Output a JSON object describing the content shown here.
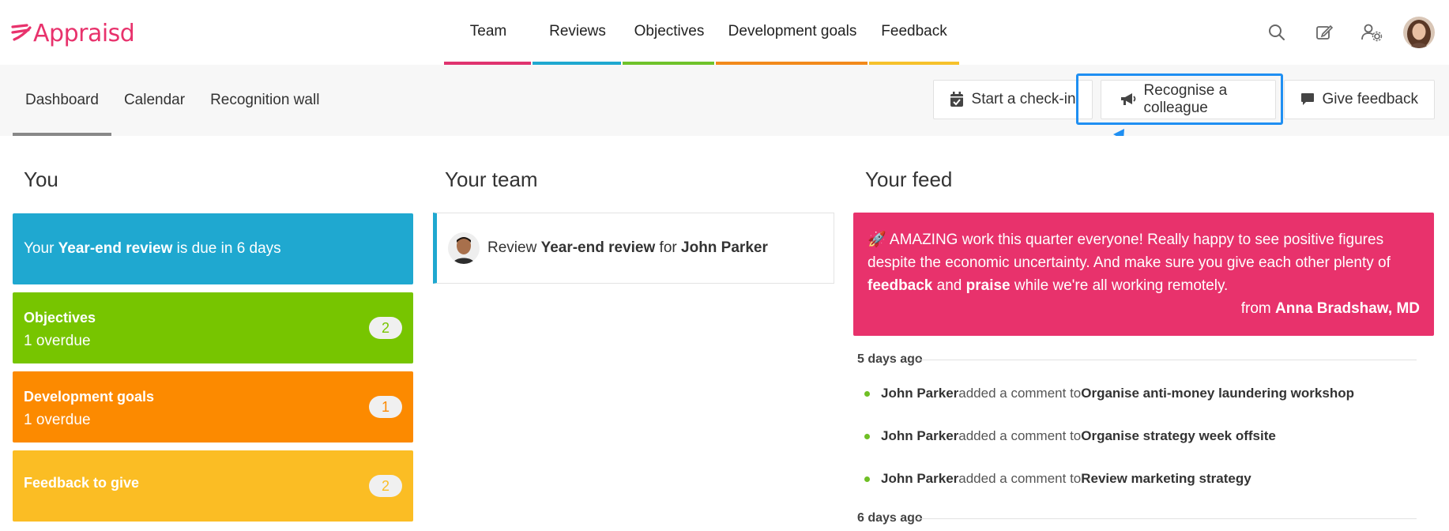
{
  "app": {
    "name": "Appraisd",
    "brand_color": "#e8326c"
  },
  "nav": {
    "items": [
      {
        "label": "Team",
        "color": "#e0336f"
      },
      {
        "label": "Reviews",
        "color": "#1fa8d0"
      },
      {
        "label": "Objectives",
        "color": "#6fc22a"
      },
      {
        "label": "Development goals",
        "color": "#f28a1c"
      },
      {
        "label": "Feedback",
        "color": "#f6c12b"
      }
    ],
    "icons": [
      "search-icon",
      "edit-icon",
      "user-settings-icon"
    ]
  },
  "subnav": {
    "tabs": [
      {
        "label": "Dashboard",
        "active": true
      },
      {
        "label": "Calendar",
        "active": false
      },
      {
        "label": "Recognition wall",
        "active": false
      }
    ],
    "actions": {
      "checkin": "Start a check-in",
      "recognise": "Recognise a colleague",
      "feedback": "Give feedback"
    }
  },
  "you": {
    "title": "You",
    "review_prefix": "Your ",
    "review_name": "Year-end review",
    "review_suffix": " is due in 6 days",
    "objectives": {
      "label": "Objectives",
      "sub": "1 overdue",
      "count": "2"
    },
    "devgoals": {
      "label": "Development goals",
      "sub": "1 overdue",
      "count": "1"
    },
    "feedback": {
      "label": "Feedback to give",
      "count": "2"
    }
  },
  "team": {
    "title": "Your team",
    "review_prefix": "Review ",
    "review_name": "Year-end review",
    "review_mid": " for ",
    "review_person": "John Parker"
  },
  "feed": {
    "title": "Your feed",
    "post": {
      "emoji": "🚀",
      "text1": " AMAZING work this quarter everyone! Really happy to see positive figures despite the economic uncertainty. And make sure you give each other plenty of ",
      "bold1": "feedback",
      "text2": " and ",
      "bold2": "praise",
      "text3": " while we're all working remotely.",
      "from_prefix": "from ",
      "from_name": "Anna Bradshaw, MD"
    },
    "groups": [
      {
        "date": "5 days ago",
        "items": [
          {
            "person": "John Parker",
            "action": " added a comment to ",
            "target": "Organise anti-money laundering workshop"
          },
          {
            "person": "John Parker",
            "action": " added a comment to ",
            "target": "Organise strategy week offsite"
          },
          {
            "person": "John Parker",
            "action": " added a comment to ",
            "target": "Review marketing strategy"
          }
        ]
      },
      {
        "date": "6 days ago",
        "items": []
      }
    ]
  }
}
